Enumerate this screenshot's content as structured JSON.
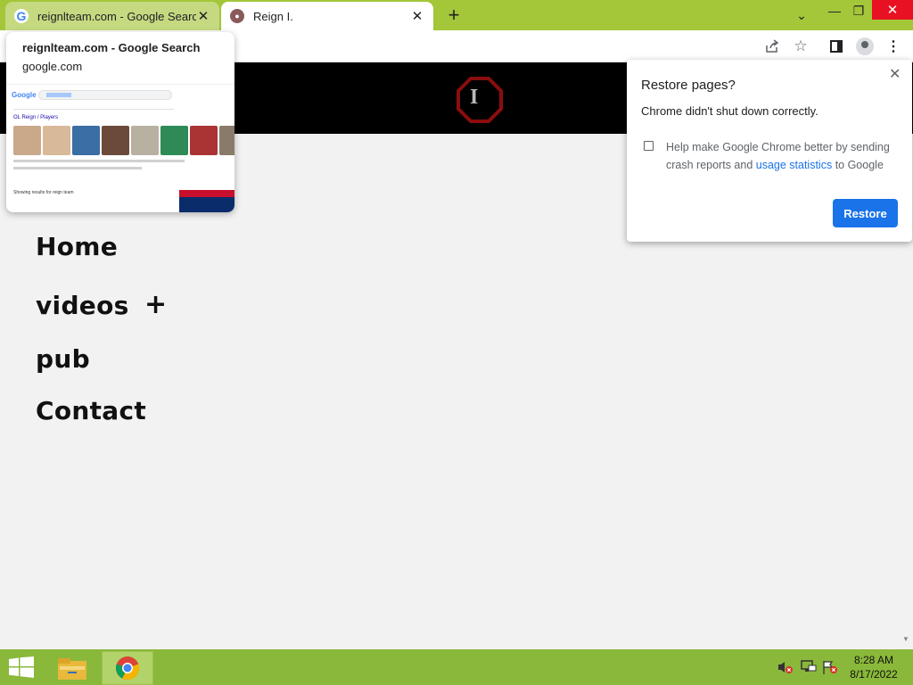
{
  "browser": {
    "tabs": [
      {
        "title": "reignlteam.com - Google Search",
        "favicon": "google-g-icon",
        "active": false
      },
      {
        "title": "Reign I.",
        "favicon": "reign-favicon-icon",
        "active": true
      }
    ],
    "new_tab_label": "+",
    "window_controls": {
      "minimize": "—",
      "maximize": "❐",
      "close": "✕"
    },
    "toolbar_icons": [
      "share-icon",
      "bookmark-star-icon",
      "side-panel-icon",
      "profile-icon",
      "menu-icon"
    ]
  },
  "hover_card": {
    "title": "reignlteam.com - Google Search",
    "domain": "google.com",
    "thumbnail": {
      "logo_text": "Google",
      "heading": "OL Reign / Players",
      "showing_text": "Showing results for reign team",
      "player_colors": [
        "#c9a98a",
        "#d8b99a",
        "#3a6ea5",
        "#6b4a3a",
        "#b8b0a0",
        "#2e8b57",
        "#a33",
        "#8a7a6a"
      ]
    }
  },
  "page": {
    "logo_letter": "I",
    "nav": {
      "home": "Home",
      "videos": "videos",
      "videos_expand": "+",
      "pub": "pub",
      "contact": "Contact"
    }
  },
  "restore_dialog": {
    "title": "Restore pages?",
    "message": "Chrome didn't shut down correctly.",
    "help_text_before": "Help make Google Chrome better by sending crash reports and ",
    "help_link": "usage statistics",
    "help_text_after": " to Google",
    "button": "Restore",
    "close": "✕"
  },
  "taskbar": {
    "apps": [
      "start-button",
      "file-explorer",
      "chrome"
    ],
    "tray_icons": [
      "volume-muted-icon",
      "network-icon",
      "action-center-flag-icon"
    ],
    "time": "8:28 AM",
    "date": "8/17/2022"
  },
  "colors": {
    "tabstrip": "#a4c639",
    "taskbar": "#8ab83a",
    "accent": "#1a73e8",
    "site_header": "#000000"
  }
}
